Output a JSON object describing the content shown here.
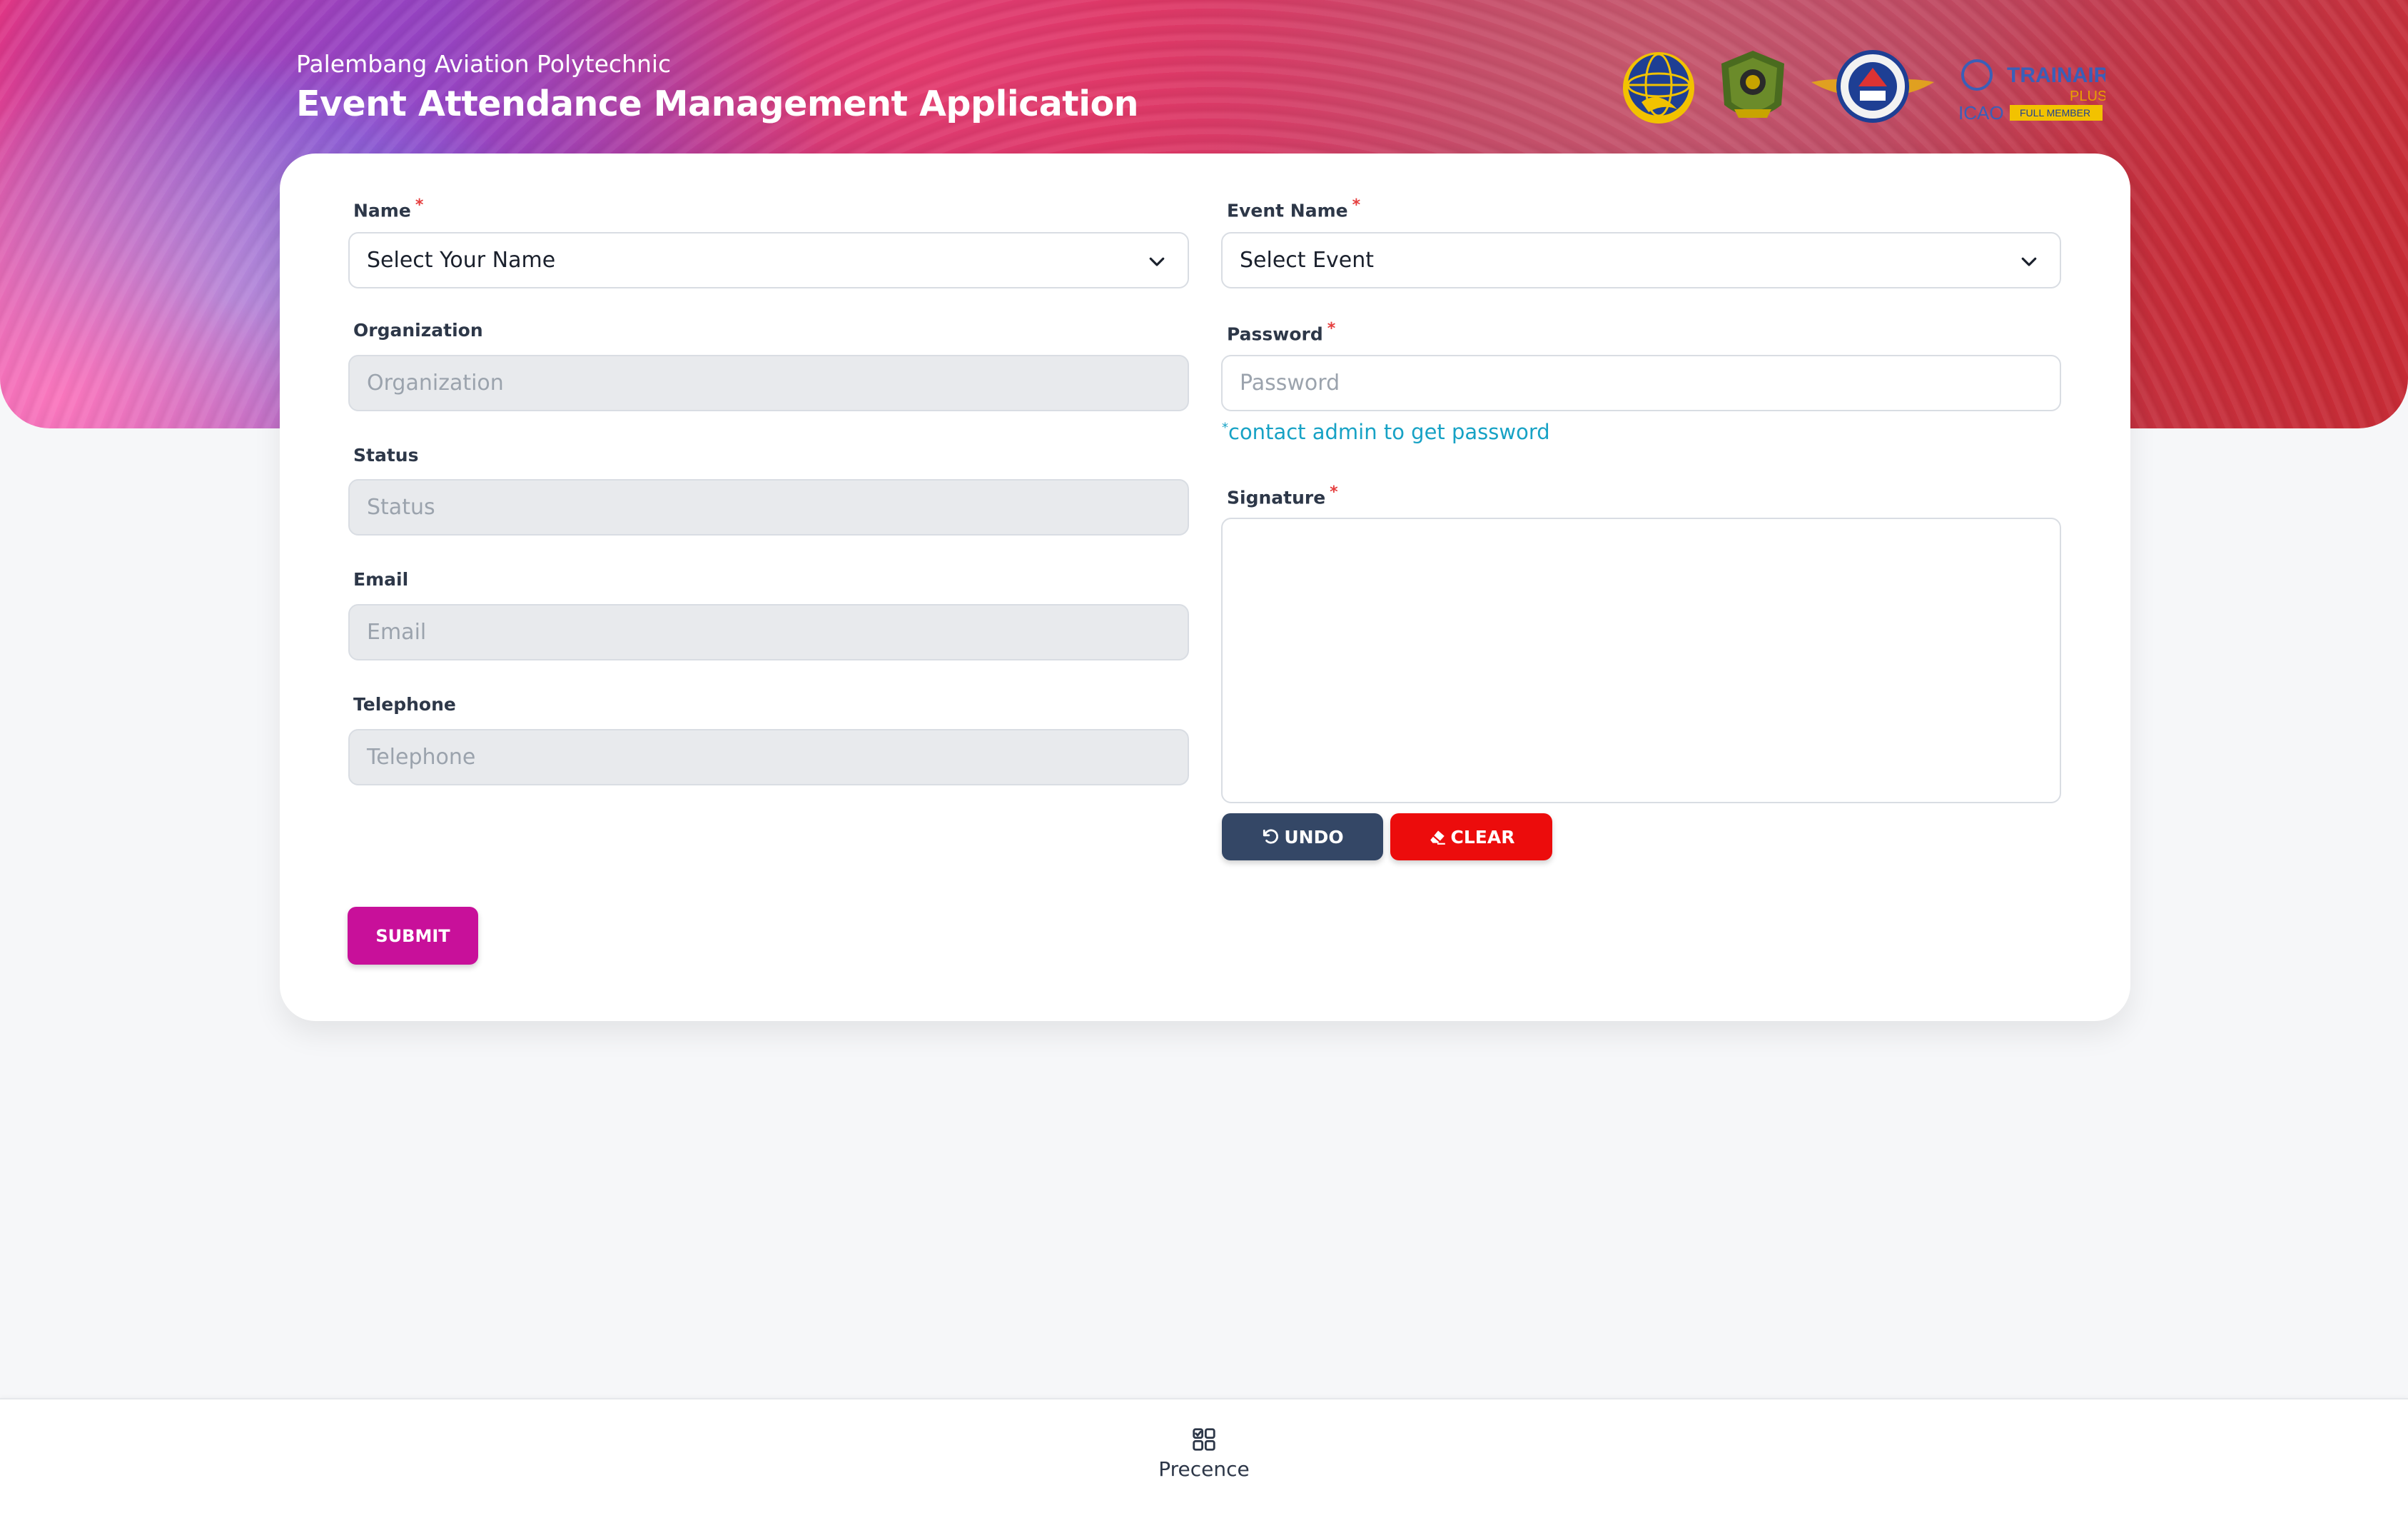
{
  "header": {
    "subtitle": "Palembang Aviation Polytechnic",
    "title": "Event Attendance Management Application",
    "logo_text": {
      "trainair": "TRAINAIR",
      "plus": "PLUS",
      "member": "FULL MEMBER",
      "org": "ICAO"
    }
  },
  "form": {
    "name": {
      "label": "Name",
      "required_mark": "*",
      "value": "Select Your Name"
    },
    "organization": {
      "label": "Organization",
      "placeholder": "Organization"
    },
    "status": {
      "label": "Status",
      "placeholder": "Status"
    },
    "email": {
      "label": "Email",
      "placeholder": "Email"
    },
    "telephone": {
      "label": "Telephone",
      "placeholder": "Telephone"
    },
    "event": {
      "label": "Event Name",
      "required_mark": "*",
      "value": "Select Event"
    },
    "password": {
      "label": "Password",
      "required_mark": "*",
      "placeholder": "Password",
      "hint_mark": "*",
      "hint": "contact admin to get password"
    },
    "signature": {
      "label": "Signature",
      "required_mark": "*"
    },
    "undo_label": "UNDO",
    "clear_label": "CLEAR",
    "submit_label": "SUBMIT"
  },
  "bottom_nav": {
    "label": "Precence",
    "icon": "grid-check-icon"
  },
  "colors": {
    "submit": "#c8109a",
    "undo": "#344766",
    "clear": "#ec0c0c",
    "hint": "#17a2c5",
    "required": "#e53e3e"
  }
}
